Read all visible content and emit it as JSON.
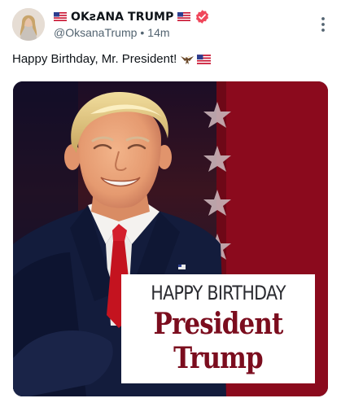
{
  "post": {
    "author": {
      "display_name": "OKꙅANA TRUMP",
      "handle": "@OksanaTrump",
      "separator": "•",
      "time_ago": "14m",
      "verified": true,
      "name_prefix_icon": "us-flag-icon",
      "name_suffix_icon": "us-flag-icon"
    },
    "text": "Happy Birthday, Mr. President!",
    "text_emojis": [
      "eagle-icon",
      "us-flag-icon"
    ],
    "menu_icon": "more-vertical-icon"
  },
  "image": {
    "line1": "HAPPY BIRTHDAY",
    "line2": "President",
    "line3": "Trump",
    "star_count": 4
  },
  "colors": {
    "background": "#ffffff",
    "text_primary": "#0f1419",
    "text_secondary": "#536471",
    "verified_badge": "#f0475b",
    "image_red": "#8b0a1d",
    "image_navy": "#0d1633",
    "card_red_text": "#7b0d1e"
  }
}
